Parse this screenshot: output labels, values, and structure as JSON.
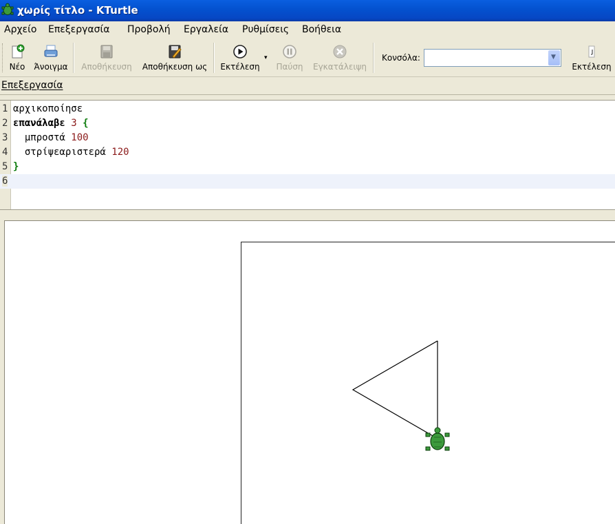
{
  "window": {
    "title": "χωρίς τίτλο - KTurtle"
  },
  "menu": [
    "Αρχείο",
    "Επεξεργασία",
    "Προβολή",
    "Εργαλεία",
    "Ρυθμίσεις",
    "Βοήθεια"
  ],
  "toolbar": {
    "new_label": "Νέο",
    "open_label": "Άνοιγμα",
    "save_label": "Αποθήκευση",
    "save_as_label": "Αποθήκευση ως",
    "run_label": "Εκτέλεση",
    "pause_label": "Παύση",
    "abort_label": "Εγκατάλειψη",
    "console_label": "Κονσόλα:",
    "console_value": "",
    "console_run_label": "Εκτέλεση"
  },
  "editor_section_label": "Επεξεργασία",
  "editor": {
    "lines": [
      {
        "num": "1",
        "code": "αρχικοποίησε"
      },
      {
        "num": "2",
        "code": "επανάλαβε 3 {"
      },
      {
        "num": "3",
        "code": "  μπροστά 100"
      },
      {
        "num": "4",
        "code": "  στρίψεαριστερά 120"
      },
      {
        "num": "5",
        "code": "}"
      },
      {
        "num": "6",
        "code": ""
      }
    ],
    "current_line": 6
  },
  "colors": {
    "turtle": "#3c9a3c",
    "line": "#000000",
    "accent": "#0a5fe0"
  },
  "icons": [
    "turtle-app-icon",
    "new-file-icon",
    "open-file-icon",
    "save-icon",
    "save-as-icon",
    "run-icon",
    "pause-icon",
    "abort-icon",
    "console-run-icon",
    "turtle-icon"
  ]
}
